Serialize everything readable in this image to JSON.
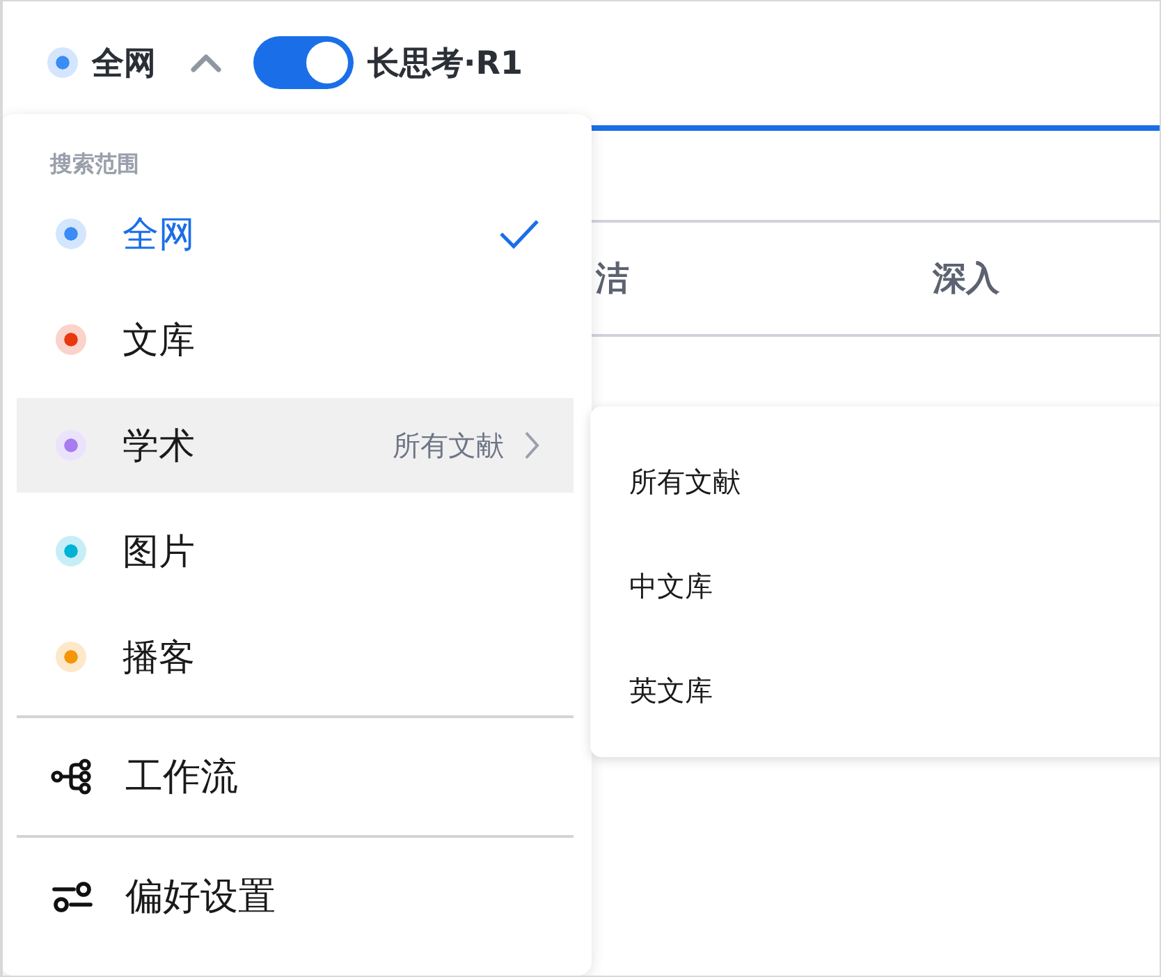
{
  "header": {
    "scope": {
      "label": "全网",
      "color": "#3b8cf5",
      "expanded": true
    },
    "toggle": {
      "on": true,
      "label": "长思考·R1"
    }
  },
  "tabs": [
    {
      "label": "洁"
    },
    {
      "label": "深入"
    }
  ],
  "scope_menu": {
    "title": "搜索范围",
    "items": [
      {
        "label": "全网",
        "color": "#3b8cf5",
        "selected": true,
        "expanded": false
      },
      {
        "label": "文库",
        "color": "#e8380d",
        "selected": false,
        "expanded": false
      },
      {
        "label": "学术",
        "color": "#a67cf0",
        "selected": false,
        "expanded": true,
        "detail": "所有文献"
      },
      {
        "label": "图片",
        "color": "#00b2d6",
        "selected": false,
        "expanded": false
      },
      {
        "label": "播客",
        "color": "#f5960a",
        "selected": false,
        "expanded": false
      }
    ],
    "actions": [
      {
        "kind": "workflow",
        "label": "工作流"
      },
      {
        "kind": "preferences",
        "label": "偏好设置"
      }
    ]
  },
  "submenu": {
    "items": [
      {
        "label": "所有文献"
      },
      {
        "label": "中文库"
      },
      {
        "label": "英文库"
      }
    ]
  }
}
